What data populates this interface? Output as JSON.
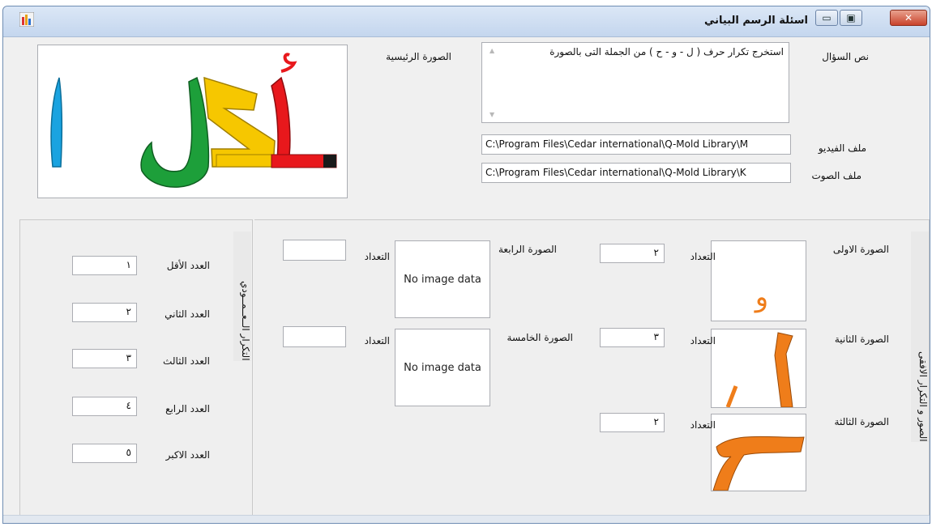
{
  "window": {
    "title": "اسئلة الرسم البياني",
    "minimize_glyph": "▭",
    "maximize_glyph": "▣",
    "close_glyph": "✕"
  },
  "question": {
    "text_label": "نص السؤال",
    "text_value": "استخرج تكرار حرف ( ل - و - ح ) من الجملة التى بالصورة",
    "video_label": "ملف الفيديو",
    "video_path": "C:\\Program Files\\Cedar international\\Q-Mold Library\\M",
    "audio_label": "ملف الصوت",
    "audio_path": "C:\\Program Files\\Cedar international\\Q-Mold Library\\K",
    "main_image_label": "الصورة الرئيسية",
    "main_image_text": "أكل ا"
  },
  "horizontal_group": {
    "title": "الصور و التكرار الافقى",
    "count_label": "التعداد",
    "no_image_text": "No image data",
    "images": [
      {
        "label": "الصورة الاولى",
        "count": "٢",
        "letter": "و"
      },
      {
        "label": "الصورة الثانية",
        "count": "٣",
        "letter": "ل"
      },
      {
        "label": "الصورة الثالثة",
        "count": "٢",
        "letter": "ح"
      },
      {
        "label": "الصورة الرابعة",
        "count": ""
      },
      {
        "label": "الصورة الخامسة",
        "count": ""
      }
    ]
  },
  "vertical_group": {
    "title": "التكرار الــعــمــودي",
    "numbers": [
      {
        "label": "العدد الأقل",
        "value": "١"
      },
      {
        "label": "العدد الثاني",
        "value": "٢"
      },
      {
        "label": "العدد الثالث",
        "value": "٣"
      },
      {
        "label": "العدد الرابع",
        "value": "٤"
      },
      {
        "label": "العدد الاكبر",
        "value": "٥"
      }
    ]
  },
  "colors": {
    "accent_orange": "#ef7d1a",
    "letter_red": "#e8181c",
    "letter_yellow": "#f6c700",
    "letter_green": "#1d9f3a",
    "letter_blue": "#1aa3e0"
  },
  "icons": {
    "app": "chart-icon"
  }
}
